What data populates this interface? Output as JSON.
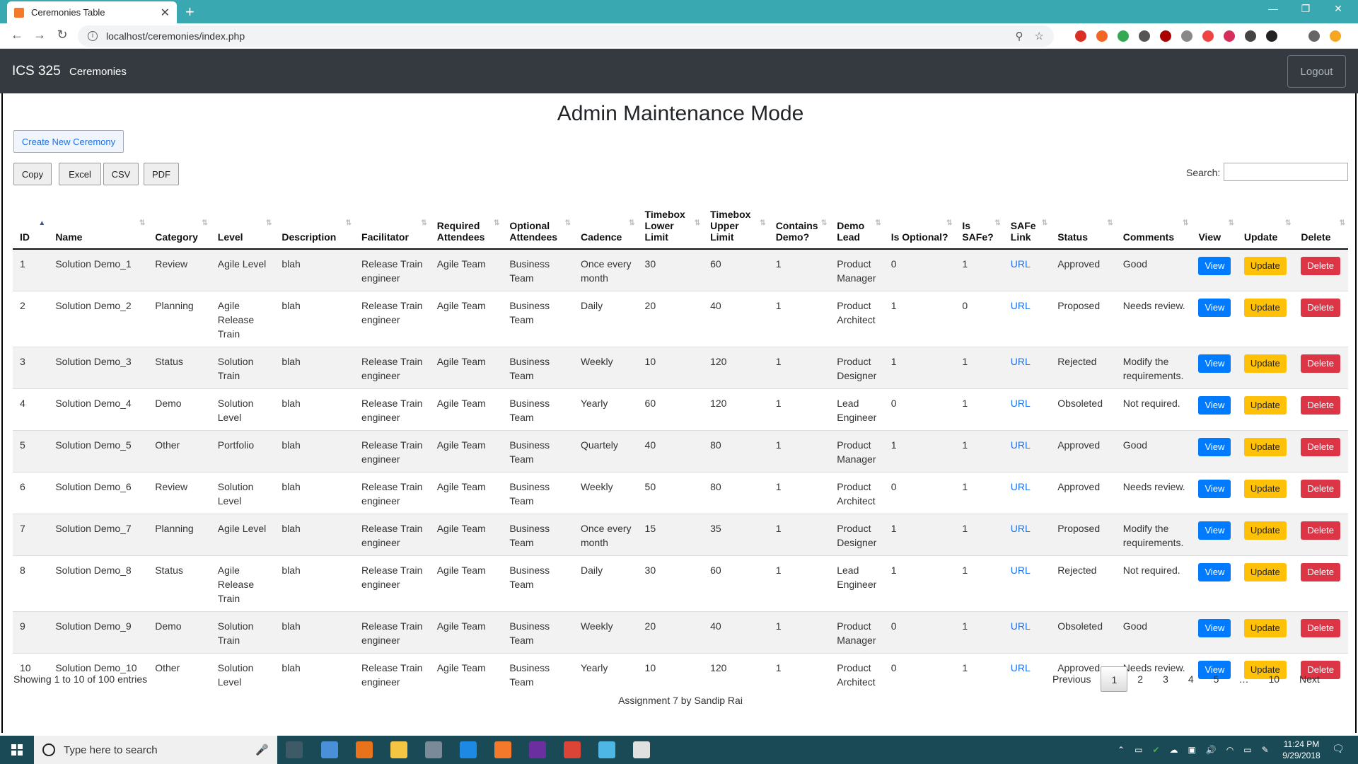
{
  "browser": {
    "tab_title": "Ceremonies Table",
    "url": "localhost/ceremonies/index.php"
  },
  "navbar": {
    "brand": "ICS 325",
    "link": "Ceremonies",
    "logout": "Logout"
  },
  "page": {
    "title": "Admin Maintenance Mode",
    "create_button": "Create New Ceremony",
    "export_buttons": [
      "Copy",
      "Excel",
      "CSV",
      "PDF"
    ],
    "search_label": "Search:",
    "search_value": ""
  },
  "table": {
    "columns": [
      "ID",
      "Name",
      "Category",
      "Level",
      "Description",
      "Facilitator",
      "Required Attendees",
      "Optional Attendees",
      "Cadence",
      "Timebox Lower Limit",
      "Timebox Upper Limit",
      "Contains Demo?",
      "Demo Lead",
      "Is Optional?",
      "Is SAFe?",
      "SAFe Link",
      "Status",
      "Comments",
      "View",
      "Update",
      "Delete"
    ],
    "action_labels": {
      "view": "View",
      "update": "Update",
      "delete": "Delete"
    },
    "rows": [
      {
        "id": "1",
        "name": "Solution Demo_1",
        "category": "Review",
        "level": "Agile Level",
        "description": "blah",
        "facilitator": "Release Train engineer",
        "required": "Agile Team",
        "optional": "Business Team",
        "cadence": "Once every month",
        "lower": "30",
        "upper": "60",
        "demo": "1",
        "lead": "Product Manager",
        "is_optional": "0",
        "is_safe": "1",
        "link": "URL",
        "status": "Approved",
        "comments": "Good"
      },
      {
        "id": "2",
        "name": "Solution Demo_2",
        "category": "Planning",
        "level": "Agile Release Train",
        "description": "blah",
        "facilitator": "Release Train engineer",
        "required": "Agile Team",
        "optional": "Business Team",
        "cadence": "Daily",
        "lower": "20",
        "upper": "40",
        "demo": "1",
        "lead": "Product Architect",
        "is_optional": "1",
        "is_safe": "0",
        "link": "URL",
        "status": "Proposed",
        "comments": "Needs review."
      },
      {
        "id": "3",
        "name": "Solution Demo_3",
        "category": "Status",
        "level": "Solution Train",
        "description": "blah",
        "facilitator": "Release Train engineer",
        "required": "Agile Team",
        "optional": "Business Team",
        "cadence": "Weekly",
        "lower": "10",
        "upper": "120",
        "demo": "1",
        "lead": "Product Designer",
        "is_optional": "1",
        "is_safe": "1",
        "link": "URL",
        "status": "Rejected",
        "comments": "Modify the requirements."
      },
      {
        "id": "4",
        "name": "Solution Demo_4",
        "category": "Demo",
        "level": "Solution Level",
        "description": "blah",
        "facilitator": "Release Train engineer",
        "required": "Agile Team",
        "optional": "Business Team",
        "cadence": "Yearly",
        "lower": "60",
        "upper": "120",
        "demo": "1",
        "lead": "Lead Engineer",
        "is_optional": "0",
        "is_safe": "1",
        "link": "URL",
        "status": "Obsoleted",
        "comments": "Not required."
      },
      {
        "id": "5",
        "name": "Solution Demo_5",
        "category": "Other",
        "level": "Portfolio",
        "description": "blah",
        "facilitator": "Release Train engineer",
        "required": "Agile Team",
        "optional": "Business Team",
        "cadence": "Quartely",
        "lower": "40",
        "upper": "80",
        "demo": "1",
        "lead": "Product Manager",
        "is_optional": "1",
        "is_safe": "1",
        "link": "URL",
        "status": "Approved",
        "comments": "Good"
      },
      {
        "id": "6",
        "name": "Solution Demo_6",
        "category": "Review",
        "level": "Solution Level",
        "description": "blah",
        "facilitator": "Release Train engineer",
        "required": "Agile Team",
        "optional": "Business Team",
        "cadence": "Weekly",
        "lower": "50",
        "upper": "80",
        "demo": "1",
        "lead": "Product Architect",
        "is_optional": "0",
        "is_safe": "1",
        "link": "URL",
        "status": "Approved",
        "comments": "Needs review."
      },
      {
        "id": "7",
        "name": "Solution Demo_7",
        "category": "Planning",
        "level": "Agile Level",
        "description": "blah",
        "facilitator": "Release Train engineer",
        "required": "Agile Team",
        "optional": "Business Team",
        "cadence": "Once every month",
        "lower": "15",
        "upper": "35",
        "demo": "1",
        "lead": "Product Designer",
        "is_optional": "1",
        "is_safe": "1",
        "link": "URL",
        "status": "Proposed",
        "comments": "Modify the requirements."
      },
      {
        "id": "8",
        "name": "Solution Demo_8",
        "category": "Status",
        "level": "Agile Release Train",
        "description": "blah",
        "facilitator": "Release Train engineer",
        "required": "Agile Team",
        "optional": "Business Team",
        "cadence": "Daily",
        "lower": "30",
        "upper": "60",
        "demo": "1",
        "lead": "Lead Engineer",
        "is_optional": "1",
        "is_safe": "1",
        "link": "URL",
        "status": "Rejected",
        "comments": "Not required."
      },
      {
        "id": "9",
        "name": "Solution Demo_9",
        "category": "Demo",
        "level": "Solution Train",
        "description": "blah",
        "facilitator": "Release Train engineer",
        "required": "Agile Team",
        "optional": "Business Team",
        "cadence": "Weekly",
        "lower": "20",
        "upper": "40",
        "demo": "1",
        "lead": "Product Manager",
        "is_optional": "0",
        "is_safe": "1",
        "link": "URL",
        "status": "Obsoleted",
        "comments": "Good"
      },
      {
        "id": "10",
        "name": "Solution Demo_10",
        "category": "Other",
        "level": "Solution Level",
        "description": "blah",
        "facilitator": "Release Train engineer",
        "required": "Agile Team",
        "optional": "Business Team",
        "cadence": "Yearly",
        "lower": "10",
        "upper": "120",
        "demo": "1",
        "lead": "Product Architect",
        "is_optional": "0",
        "is_safe": "1",
        "link": "URL",
        "status": "Approved",
        "comments": "Needs review."
      }
    ]
  },
  "info": "Showing 1 to 10 of 100 entries",
  "pagination": [
    "Previous",
    "1",
    "2",
    "3",
    "4",
    "5",
    "…",
    "10",
    "Next"
  ],
  "footer": "Assignment 7 by Sandip Rai",
  "taskbar": {
    "search_placeholder": "Type here to search",
    "time": "11:24 PM",
    "date": "9/29/2018"
  },
  "colors": {
    "navbar": "#343a40",
    "view": "#007bff",
    "update": "#ffc107",
    "delete": "#dc3545",
    "tabbar": "#3aa8b0"
  }
}
